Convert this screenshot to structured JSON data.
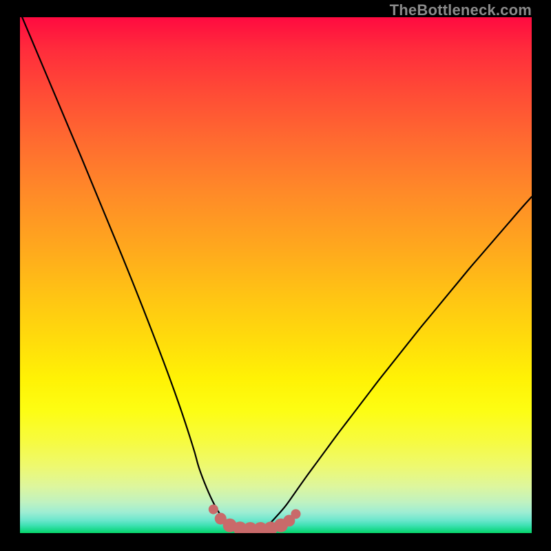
{
  "watermark": "TheBottleneck.com",
  "colors": {
    "border": "#000000",
    "curve": "#000000",
    "marker_fill": "#c96a6a",
    "marker_stroke": "#a94a4a"
  },
  "chart_data": {
    "type": "line",
    "title": "",
    "xlabel": "",
    "ylabel": "",
    "xlim": [
      0,
      100
    ],
    "ylim": [
      0,
      100
    ],
    "grid": false,
    "legend": false,
    "annotations": [],
    "series": [
      {
        "name": "bottleneck-curve",
        "x": [
          0,
          2,
          4,
          6,
          8,
          10,
          12,
          14,
          16,
          18,
          20,
          22,
          24,
          26,
          28,
          30,
          32,
          34,
          35.0,
          36.5,
          38,
          39.5,
          41,
          42.5,
          44,
          45.5,
          47,
          48.5,
          50,
          52,
          54,
          56,
          58,
          60,
          62,
          64,
          66,
          68,
          70,
          72,
          74,
          76,
          78,
          80,
          82,
          84,
          86,
          88,
          90,
          92,
          94,
          96,
          98,
          100
        ],
        "y": [
          101,
          96.3,
          91.6,
          86.9,
          82.2,
          77.5,
          72.8,
          68.0,
          63.2,
          58.4,
          53.6,
          48.7,
          43.7,
          38.6,
          33.4,
          28.0,
          22.3,
          16.1,
          12.6,
          8.7,
          5.5,
          3.1,
          1.6,
          0.8,
          0.55,
          0.55,
          0.8,
          1.6,
          3.1,
          5.4,
          8.2,
          11.0,
          13.7,
          16.4,
          19.1,
          21.7,
          24.3,
          26.9,
          29.5,
          32.0,
          34.5,
          37.0,
          39.5,
          41.9,
          44.3,
          46.7,
          49.1,
          51.5,
          53.8,
          56.1,
          58.4,
          60.7,
          63.0,
          65.2
        ]
      }
    ],
    "markers": {
      "name": "optimal-range-markers",
      "x_normalized": [
        0.378,
        0.392,
        0.41,
        0.43,
        0.45,
        0.47,
        0.49,
        0.51,
        0.526,
        0.539
      ],
      "y_normalized": [
        0.046,
        0.028,
        0.015,
        0.009,
        0.008,
        0.008,
        0.009,
        0.015,
        0.024,
        0.037
      ],
      "radius_normalized": [
        0.0095,
        0.0115,
        0.0135,
        0.0135,
        0.0135,
        0.0135,
        0.0135,
        0.0135,
        0.0115,
        0.0095
      ]
    }
  }
}
